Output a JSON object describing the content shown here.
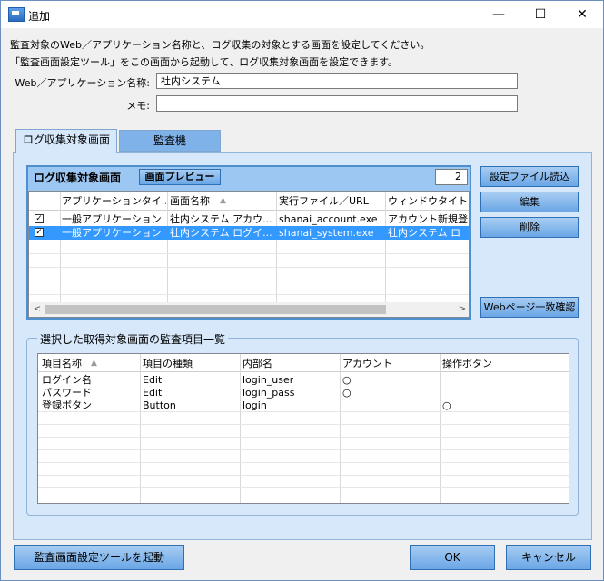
{
  "window": {
    "title": "追加",
    "minimize": "—",
    "maximize": "☐",
    "close": "✕"
  },
  "description": {
    "line1": "監査対象のWeb／アプリケーション名称と、ログ収集の対象とする画面を設定してください。",
    "line2": "「監査画面設定ツール」をこの画面から起動して、ログ収集対象画面を設定できます。"
  },
  "fields": {
    "app_name_label": "Web／アプリケーション名称:",
    "app_name_value": "社内システム",
    "memo_label": "メモ:",
    "memo_value": ""
  },
  "tabs": [
    {
      "label": "ログ収集対象画面"
    },
    {
      "label": "監査機"
    }
  ],
  "target_group": {
    "title": "ログ収集対象画面",
    "preview_button": "画面プレビュー",
    "count": "2",
    "columns": [
      "",
      "アプリケーションタイ...",
      "画面名称",
      "実行ファイル／URL",
      "ウィンドウタイトル"
    ],
    "rows": [
      {
        "checked": "✓",
        "app_type": "一般アプリケーション",
        "screen_name": "社内システム アカウ...",
        "exe": "shanai_account.exe",
        "window_title": "アカウント新規登"
      },
      {
        "checked": "✓",
        "app_type": "一般アプリケーション",
        "screen_name": "社内システム ログイ...",
        "exe": "shanai_system.exe",
        "window_title": "社内システム ロ"
      }
    ]
  },
  "side_buttons": {
    "load": "設定ファイル読込",
    "edit": "編集",
    "delete": "削除",
    "web_check": "Webページ一致確認"
  },
  "items_group": {
    "title": "選択した取得対象画面の監査項目一覧",
    "columns": [
      "項目名称",
      "項目の種類",
      "内部名",
      "アカウント",
      "操作ボタン"
    ],
    "rows": [
      {
        "name": "ログイン名",
        "type": "Edit",
        "internal": "login_user",
        "account": "○",
        "button": ""
      },
      {
        "name": "パスワード",
        "type": "Edit",
        "internal": "login_pass",
        "account": "○",
        "button": ""
      },
      {
        "name": "登録ボタン",
        "type": "Button",
        "internal": "login",
        "account": "",
        "button": "○"
      }
    ]
  },
  "footer": {
    "launch_tool": "監査画面設定ツールを起動",
    "ok": "OK",
    "cancel": "キャンセル"
  },
  "colors": {
    "selection": "#3399ff",
    "panel": "#d6e8fa",
    "group": "#9cc7f2",
    "button": "#7fb2e8"
  }
}
